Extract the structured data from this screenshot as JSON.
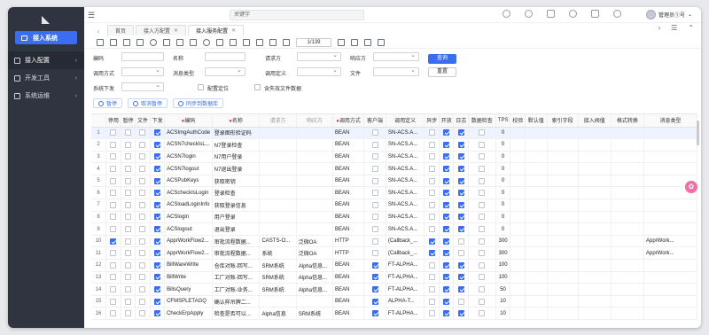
{
  "sidebar": {
    "system_button": "接入系统",
    "items": [
      {
        "label": "接入配置",
        "active": true
      },
      {
        "label": "开发工具",
        "active": false
      },
      {
        "label": "系统运维",
        "active": false
      }
    ]
  },
  "topbar": {
    "search_placeholder": "关键字",
    "user_name": "管理员①号"
  },
  "tabs": [
    {
      "label": "首页",
      "closable": false,
      "active": false
    },
    {
      "label": "接入方配置",
      "closable": true,
      "active": false
    },
    {
      "label": "接入服务配置",
      "closable": true,
      "active": true
    }
  ],
  "pager": {
    "value": "1/139"
  },
  "filters": {
    "code_label": "编码",
    "name_label": "名称",
    "requester_label": "请求方",
    "responder_label": "响应方",
    "call_method_label": "调用方式",
    "msg_type_label": "消息类型",
    "call_def_label": "调用定义",
    "file_label": "文件",
    "sys_send_label": "系统下发",
    "config_pos_label": "配置定位",
    "include_invalid_label": "含失效文件数据",
    "query_button": "查询",
    "reset_button": "重置"
  },
  "actions": {
    "pause": "暂停",
    "cancel_pause": "取消暂停",
    "sync_db": "同步到数据库"
  },
  "table": {
    "columns": [
      "",
      "停用",
      "暂停",
      "文件",
      "下发",
      "编码",
      "名称",
      "请求方",
      "响应方",
      "调用方式",
      "客户端",
      "调用定义",
      "异步",
      "开放",
      "日志",
      "数据检查",
      "TPS",
      "校验",
      "默认值",
      "索引字段",
      "接入阀值",
      "格式转换",
      "消息类型"
    ],
    "rows": [
      {
        "n": "1",
        "stop": false,
        "pause": false,
        "file": false,
        "send": true,
        "code": "ACSImgAuthCode",
        "name": "登录图形验证码",
        "req": "",
        "resp": "",
        "method": "BEAN",
        "client": false,
        "def": "SN-ACS.A...",
        "async": false,
        "open": true,
        "log": true,
        "check": false,
        "tps": "0",
        "msgtype": ""
      },
      {
        "n": "2",
        "stop": false,
        "pause": false,
        "file": false,
        "send": true,
        "code": "ACSN7checkIsL...",
        "name": "N7登录检查",
        "req": "",
        "resp": "",
        "method": "BEAN",
        "client": false,
        "def": "SN-ACS.A...",
        "async": false,
        "open": true,
        "log": true,
        "check": false,
        "tps": "0",
        "msgtype": ""
      },
      {
        "n": "3",
        "stop": false,
        "pause": false,
        "file": false,
        "send": true,
        "code": "ACSN7login",
        "name": "N7用户登录",
        "req": "",
        "resp": "",
        "method": "BEAN",
        "client": false,
        "def": "SN-ACS.A...",
        "async": false,
        "open": true,
        "log": true,
        "check": false,
        "tps": "0",
        "msgtype": ""
      },
      {
        "n": "4",
        "stop": false,
        "pause": false,
        "file": false,
        "send": true,
        "code": "ACSN7logout",
        "name": "N7退出登录",
        "req": "",
        "resp": "",
        "method": "BEAN",
        "client": false,
        "def": "SN-ACS.A...",
        "async": false,
        "open": true,
        "log": true,
        "check": false,
        "tps": "0",
        "msgtype": ""
      },
      {
        "n": "5",
        "stop": false,
        "pause": false,
        "file": false,
        "send": true,
        "code": "ACSPubKeys",
        "name": "获取密钥",
        "req": "",
        "resp": "",
        "method": "BEAN",
        "client": false,
        "def": "SN-ACS.A...",
        "async": false,
        "open": true,
        "log": true,
        "check": false,
        "tps": "0",
        "msgtype": ""
      },
      {
        "n": "6",
        "stop": false,
        "pause": false,
        "file": false,
        "send": true,
        "code": "ACScheckIsLogin",
        "name": "登录检查",
        "req": "",
        "resp": "",
        "method": "BEAN",
        "client": false,
        "def": "SN-ACS.A...",
        "async": false,
        "open": true,
        "log": true,
        "check": false,
        "tps": "0",
        "msgtype": ""
      },
      {
        "n": "7",
        "stop": false,
        "pause": false,
        "file": false,
        "send": true,
        "code": "ACSloadLoginInfo",
        "name": "获取登录信息",
        "req": "",
        "resp": "",
        "method": "BEAN",
        "client": false,
        "def": "SN-ACS.A...",
        "async": false,
        "open": true,
        "log": true,
        "check": false,
        "tps": "0",
        "msgtype": ""
      },
      {
        "n": "8",
        "stop": false,
        "pause": false,
        "file": false,
        "send": true,
        "code": "ACSlogin",
        "name": "用户登录",
        "req": "",
        "resp": "",
        "method": "BEAN",
        "client": false,
        "def": "SN-ACS.A...",
        "async": false,
        "open": true,
        "log": true,
        "check": false,
        "tps": "0",
        "msgtype": ""
      },
      {
        "n": "9",
        "stop": false,
        "pause": false,
        "file": false,
        "send": true,
        "code": "ACSlogout",
        "name": "退出登录",
        "req": "",
        "resp": "",
        "method": "BEAN",
        "client": false,
        "def": "SN-ACS.A...",
        "async": false,
        "open": true,
        "log": true,
        "check": false,
        "tps": "0",
        "msgtype": ""
      },
      {
        "n": "10",
        "stop": true,
        "pause": false,
        "file": false,
        "send": true,
        "code": "ApprWorkFlow2...",
        "name": "审批流程数据...",
        "req": "CASTS-O...",
        "resp": "泛微OA",
        "method": "HTTP",
        "client": false,
        "def": "{Callback_...",
        "async": true,
        "open": true,
        "log": false,
        "check": false,
        "tps": "300",
        "msgtype": "ApprWork..."
      },
      {
        "n": "11",
        "stop": false,
        "pause": false,
        "file": false,
        "send": true,
        "code": "ApprWorkFlow2...",
        "name": "审批流程数据...",
        "req": "系统",
        "resp": "泛微OA",
        "method": "HTTP",
        "client": false,
        "def": "{Callback_...",
        "async": true,
        "open": true,
        "log": false,
        "check": false,
        "tps": "300",
        "msgtype": "ApprWork..."
      },
      {
        "n": "12",
        "stop": false,
        "pause": false,
        "file": false,
        "send": true,
        "code": "BillWareWrite",
        "name": "仓库对账-回写...",
        "req": "SRM系统",
        "resp": "Alpha信息...",
        "method": "BEAN",
        "client": true,
        "def": "FT-ALPHA...",
        "async": false,
        "open": true,
        "log": true,
        "check": false,
        "tps": "100",
        "msgtype": ""
      },
      {
        "n": "13",
        "stop": false,
        "pause": false,
        "file": false,
        "send": true,
        "code": "BillWrite",
        "name": "工厂对账-回写...",
        "req": "SRM系统",
        "resp": "Alpha信息...",
        "method": "BEAN",
        "client": true,
        "def": "FT-ALPHA...",
        "async": false,
        "open": true,
        "log": true,
        "check": false,
        "tps": "100",
        "msgtype": ""
      },
      {
        "n": "14",
        "stop": false,
        "pause": false,
        "file": false,
        "send": true,
        "code": "BillsQuery",
        "name": "工厂对账-业务...",
        "req": "SRM系统",
        "resp": "Alpha信息...",
        "method": "BEAN",
        "client": true,
        "def": "FT-ALPHA...",
        "async": false,
        "open": true,
        "log": true,
        "check": false,
        "tps": "50",
        "msgtype": ""
      },
      {
        "n": "15",
        "stop": false,
        "pause": false,
        "file": false,
        "send": true,
        "code": "CFMSPLETAGQ",
        "name": "确认样吊牌二...",
        "req": "",
        "resp": "",
        "method": "BEAN",
        "client": true,
        "def": "ALPHA-T...",
        "async": false,
        "open": true,
        "log": false,
        "check": false,
        "tps": "10",
        "msgtype": ""
      },
      {
        "n": "16",
        "stop": false,
        "pause": false,
        "file": false,
        "send": true,
        "code": "CheckErpApply",
        "name": "检查是否可以...",
        "req": "Alpha信息",
        "resp": "SRM系统",
        "method": "BEAN",
        "client": true,
        "def": "FT-ALPHA...",
        "async": false,
        "open": true,
        "log": true,
        "check": false,
        "tps": "10",
        "msgtype": ""
      }
    ]
  },
  "colors": {
    "accent": "#3b6df0",
    "sidebar": "#2f3440"
  }
}
